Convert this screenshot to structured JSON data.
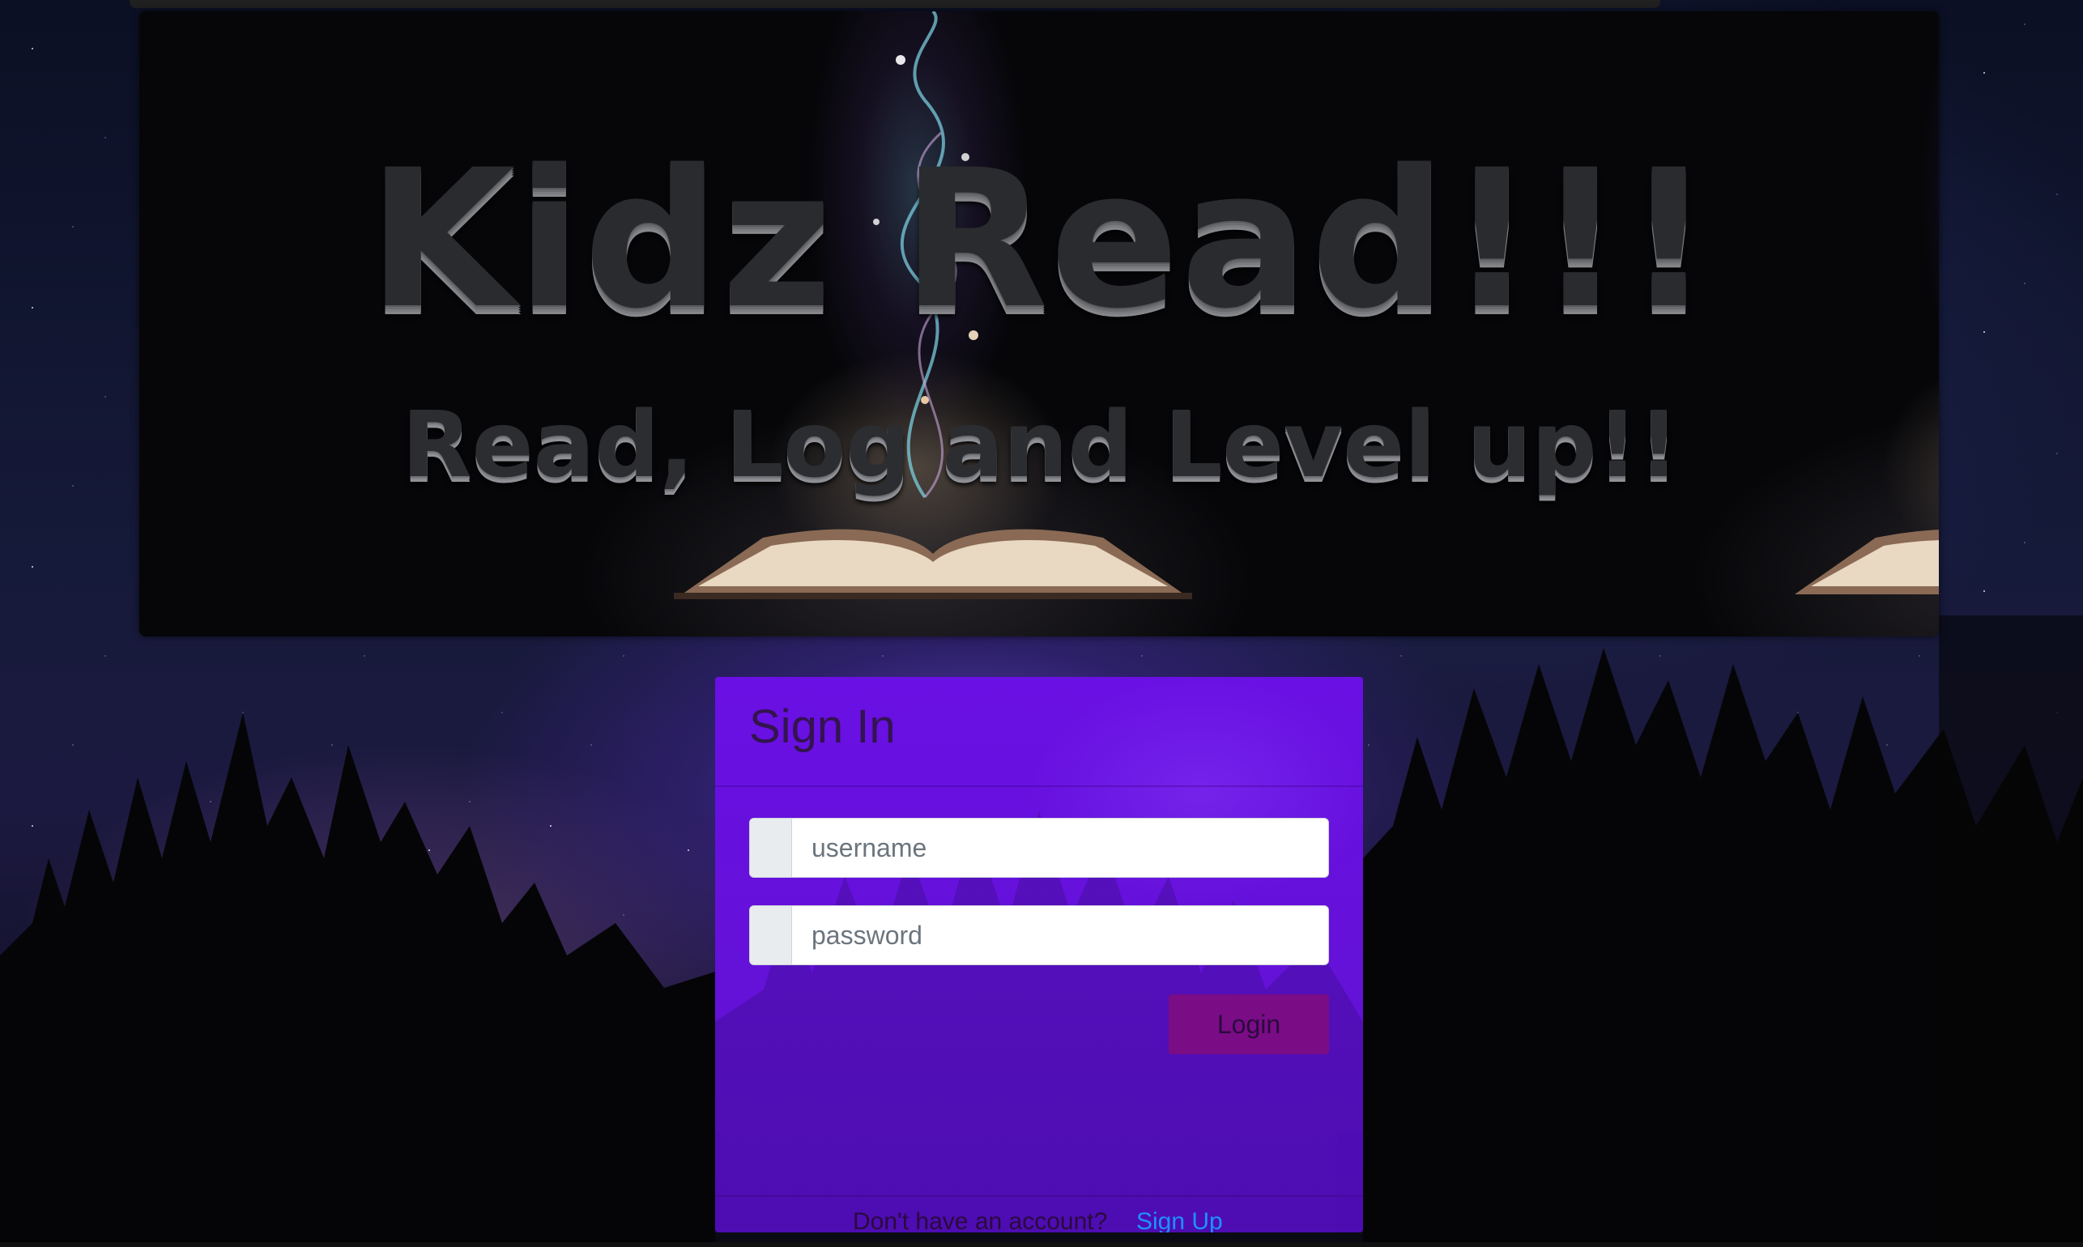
{
  "banner": {
    "title": "Kidz Read!!!",
    "subtitle": "Read, Log and Level up!!"
  },
  "signin": {
    "title": "Sign In",
    "username_placeholder": "username",
    "password_placeholder": "password",
    "login_label": "Login",
    "footer_text": "Don't have an account?",
    "signup_label": "Sign Up"
  },
  "colors": {
    "card_background": "#6410dc",
    "login_button": "#7a0c86",
    "link": "#1e90ff",
    "title_text": "#2a2b2e"
  },
  "icons": {
    "username_prepend": "user-icon",
    "password_prepend": "lock-icon"
  }
}
